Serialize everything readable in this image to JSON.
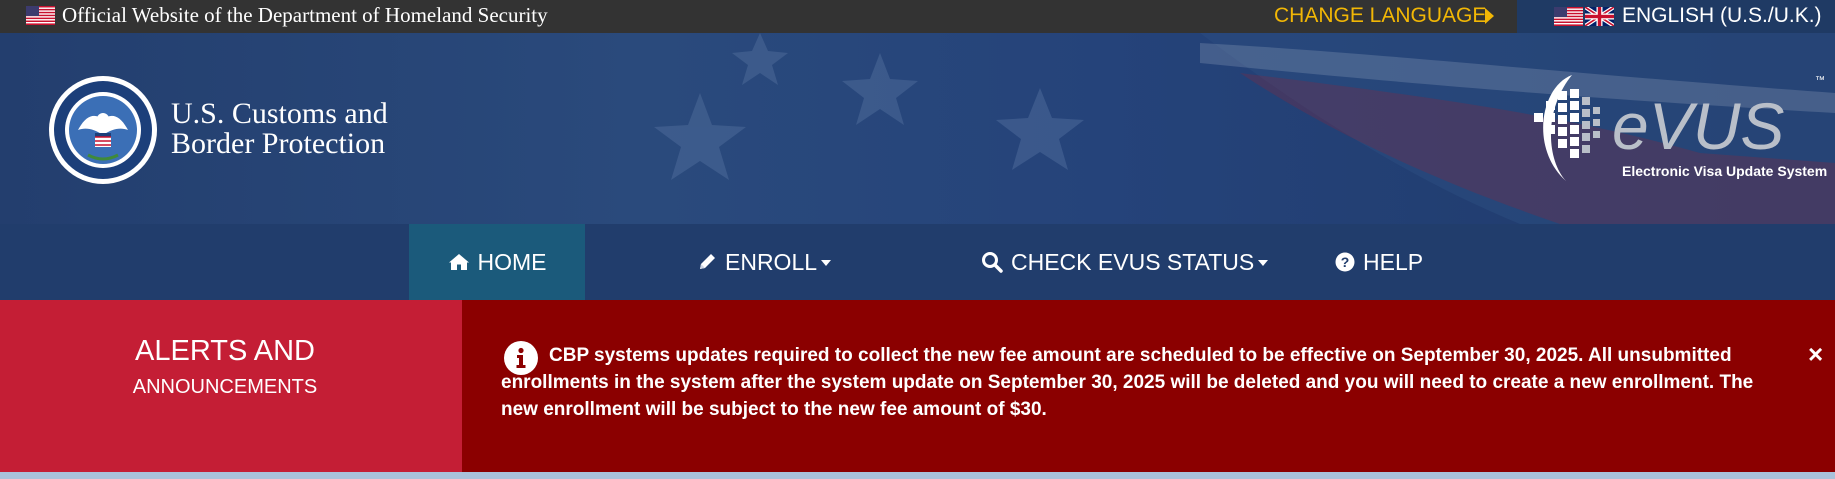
{
  "topbar": {
    "gov_text": "Official Website of the Department of Homeland Security",
    "change_language": "CHANGE LANGUAGE",
    "current_language": "ENGLISH (U.S./U.K.)"
  },
  "header": {
    "agency_line1": "U.S. Customs and",
    "agency_line2": "Border Protection",
    "logo_name": "eVUS",
    "logo_tagline": "Electronic Visa Update System",
    "trademark": "™"
  },
  "nav": {
    "items": [
      {
        "label": "HOME",
        "icon": "home-icon",
        "active": true
      },
      {
        "label": "ENROLL",
        "icon": "pencil-icon",
        "dropdown": true
      },
      {
        "label": "CHECK EVUS STATUS",
        "icon": "search-icon",
        "dropdown": true
      },
      {
        "label": "HELP",
        "icon": "question-icon"
      }
    ]
  },
  "alerts": {
    "title": "ALERTS AND",
    "subtitle": "ANNOUNCEMENTS",
    "message": "CBP systems updates required to collect the new fee amount are scheduled to be effective on September 30, 2025. All unsubmitted enrollments in the system after the system update on September 30, 2025 will be deleted and you will need to create a new enrollment. The new enrollment will be subject to the new fee amount of $30.",
    "close": "×"
  },
  "colors": {
    "topbar": "#333333",
    "accent_yellow": "#f2b705",
    "nav_bg": "#213d6c",
    "nav_active": "#1b5a7b",
    "alert_label_bg": "#c41e35",
    "alert_bg": "#8b0000"
  }
}
